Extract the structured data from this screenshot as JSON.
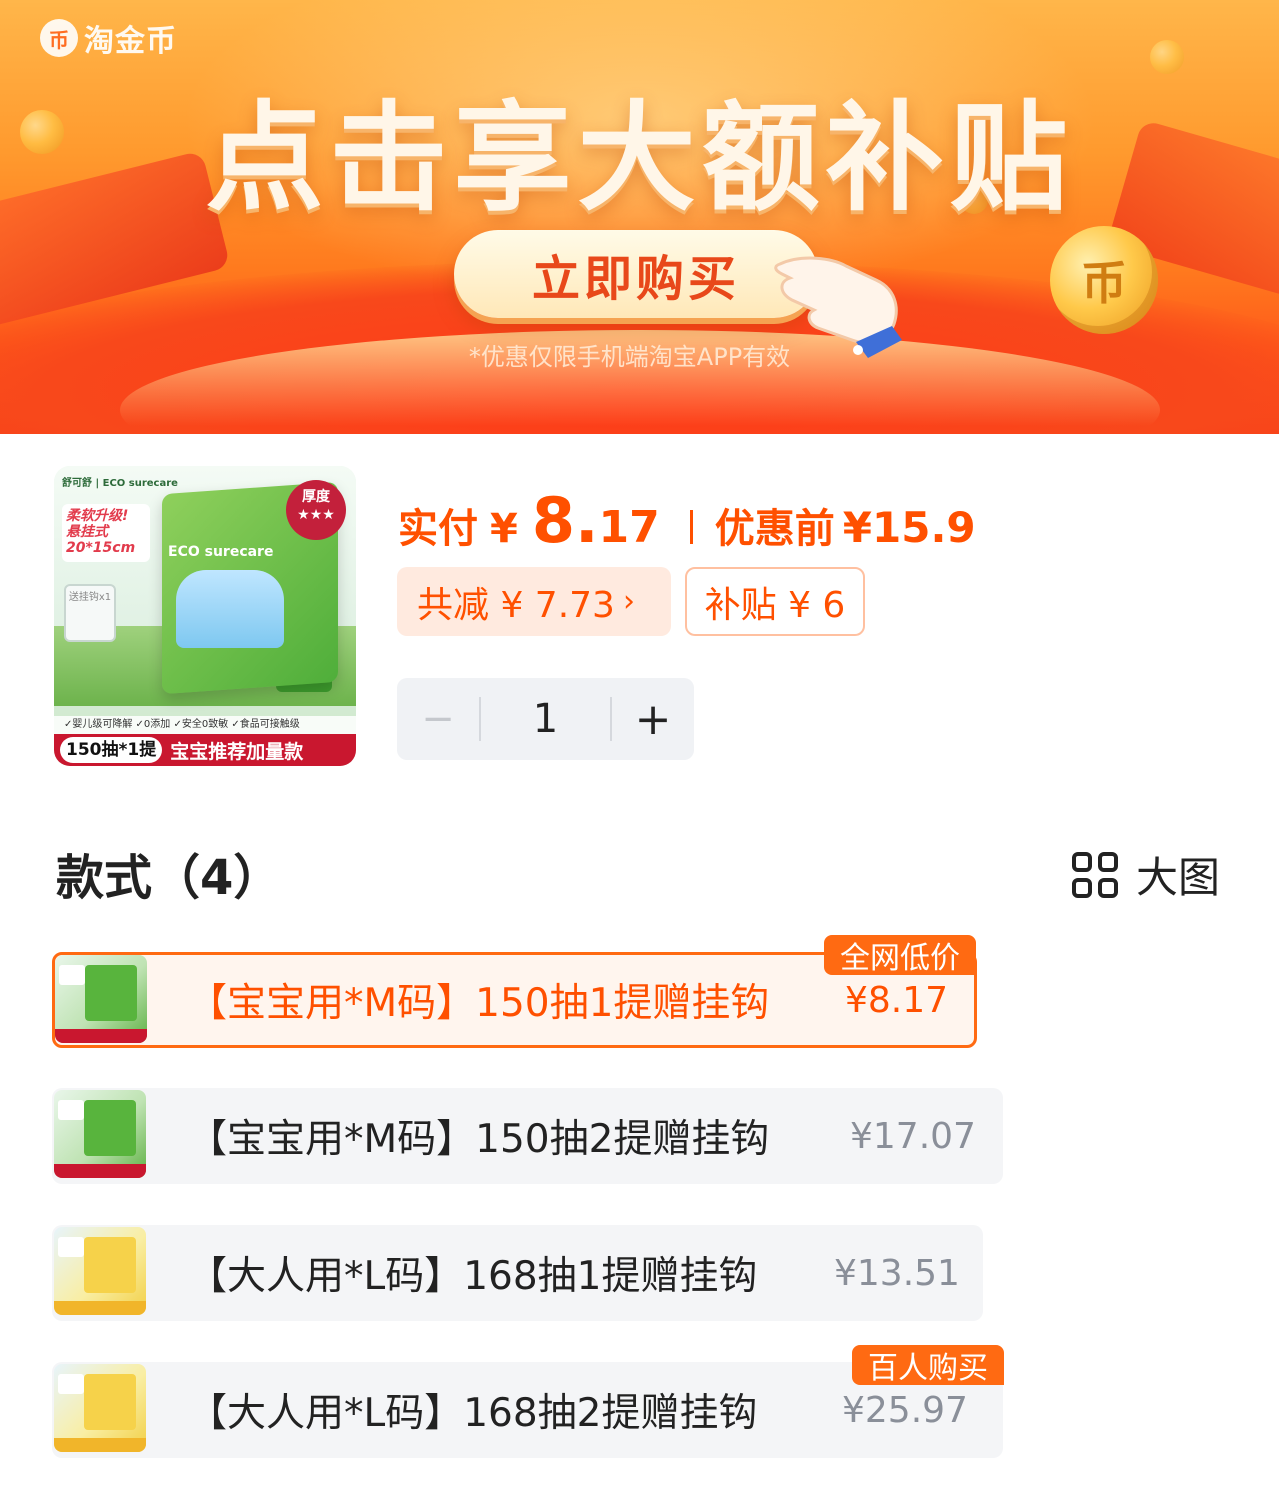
{
  "banner": {
    "brand": "淘金币",
    "brand_icon": "coin-icon",
    "headline": "点击享大额补贴",
    "buy_button": "立即购买",
    "note": "*优惠仅限手机端淘宝APP有效",
    "coin_glyph": "币"
  },
  "product": {
    "thumb": {
      "tag_soft": "柔软升级! 悬挂式 20*15cm",
      "hook_label": "送挂钩x1",
      "badge": "厚度 ★★★",
      "brand_strip": "舒可舒 | ECO surecare",
      "pack_label": "ECO surecare",
      "checks": "✓婴儿级可降解 ✓0添加 ✓安全0致敏 ✓食品可接触级",
      "bottom_pill": "150抽*1提",
      "bottom_text": "宝宝推荐加量款"
    },
    "price": {
      "paid_label": "实付",
      "currency": "¥",
      "paid_int": "8",
      "paid_dot": ".",
      "paid_dec": "17",
      "before_label": "优惠前",
      "before_value": "¥15.9"
    },
    "reduce_chip": "共减 ¥ 7.73",
    "reduce_arrow": "›",
    "subsidy_chip": "补贴 ¥ 6",
    "quantity": {
      "minus": "−",
      "value": "1",
      "plus": "+"
    }
  },
  "variants": {
    "title": "款式（4）",
    "view_label": "大图",
    "view_icon": "grid-icon",
    "items": [
      {
        "name": "【宝宝用*M码】150抽1提赠挂钩",
        "price": "¥8.17",
        "badge": "全网低价",
        "selected": true
      },
      {
        "name": "【宝宝用*M码】150抽2提赠挂钩",
        "price": "¥17.07",
        "badge": "",
        "selected": false
      },
      {
        "name": "【大人用*L码】168抽1提赠挂钩",
        "price": "¥13.51",
        "badge": "",
        "selected": false
      },
      {
        "name": "【大人用*L码】168抽2提赠挂钩",
        "price": "¥25.97",
        "badge": "百人购买",
        "selected": false
      }
    ]
  },
  "colors": {
    "accent": "#ff5000",
    "selected_border": "#ff6a12",
    "banner_top": "#ffb64a",
    "banner_bottom": "#f8421a"
  }
}
